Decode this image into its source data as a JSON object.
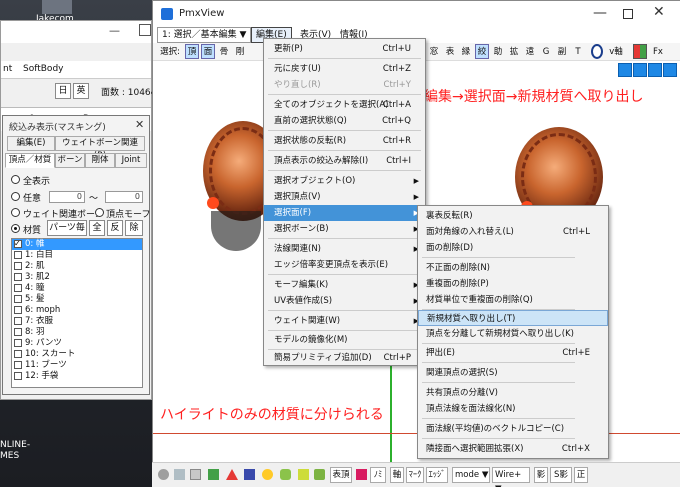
{
  "desktop": {
    "icon_label": "Jakecom",
    "bottom_lines": [
      "NLINE-",
      "MES"
    ]
  },
  "left_window": {
    "menu": [
      "nt",
      "SoftBody"
    ],
    "toolbar": {
      "mode_label": "日",
      "en_label": "英",
      "count_label": "面数 : 10464"
    },
    "table_header": [
      "",
      "0",
      "",
      "B"
    ]
  },
  "mask_window": {
    "title": "絞込み表示(マスキング)",
    "close": "✕",
    "tabs_row1": [
      "編集(E)",
      "ウェイトボーン関連(B)"
    ],
    "tabs_row2": [
      "頂点／材質",
      "ボーン",
      "剛体",
      "Joint"
    ],
    "radios": [
      {
        "label": "全表示",
        "on": false
      },
      {
        "label": "任意",
        "on": false,
        "num1": "0",
        "sep": "～",
        "num2": "0"
      },
      {
        "label": "ウェイト関連ボーン",
        "on": false,
        "extra": "頂点モーフ"
      },
      {
        "label": "材質",
        "on": true
      }
    ],
    "material_buttons": [
      "パーツ毎",
      "全",
      "反",
      "除"
    ],
    "materials": [
      {
        "label": "0: 帷",
        "checked": true,
        "selected": true
      },
      {
        "label": "1: 白目",
        "checked": false
      },
      {
        "label": "2: 肌",
        "checked": false
      },
      {
        "label": "3: 肌2",
        "checked": false
      },
      {
        "label": "4: 瞳",
        "checked": false
      },
      {
        "label": "5: 髪",
        "checked": false
      },
      {
        "label": "6: moph",
        "checked": false
      },
      {
        "label": "7: 衣服",
        "checked": false
      },
      {
        "label": "8: 羽",
        "checked": false
      },
      {
        "label": "9: パンツ",
        "checked": false
      },
      {
        "label": "10: スカート",
        "checked": false
      },
      {
        "label": "11: ブーツ",
        "checked": false
      },
      {
        "label": "12: 手袋",
        "checked": false
      }
    ]
  },
  "main_window": {
    "title": "PmxView",
    "minimize": "—",
    "close": "✕",
    "menubar": [
      "1: 選択／基本編集",
      "▼",
      "編集(E)",
      "表示(V)",
      "情報(I)"
    ],
    "toolbar_left": [
      "選択:",
      "頂",
      "面",
      "骨",
      "剛"
    ],
    "toolbar_right": [
      "窓",
      "表",
      "縁",
      "絞",
      "助",
      "拡",
      "遠",
      "G",
      "副",
      "T",
      "v軸",
      "Fx"
    ]
  },
  "annotations": {
    "top": "編集→選択面→新規材質へ取り出し",
    "bottom": "ハイライトのみの材質に分けられる"
  },
  "edit_menu": {
    "items": [
      {
        "label": "更新(P)",
        "key": "Ctrl+U"
      },
      {
        "sep": true
      },
      {
        "label": "元に戻す(U)",
        "key": "Ctrl+Z"
      },
      {
        "label": "やり直し(R)",
        "key": "Ctrl+Y",
        "disabled": true
      },
      {
        "sep": true
      },
      {
        "label": "全てのオブジェクトを選択(A)",
        "key": "Ctrl+A"
      },
      {
        "label": "直前の選択状態(Q)",
        "key": "Ctrl+Q"
      },
      {
        "sep": true
      },
      {
        "label": "選択状態の反転(R)",
        "key": "Ctrl+R"
      },
      {
        "sep": true
      },
      {
        "label": "頂点表示の絞込み解除(I)",
        "key": "Ctrl+I"
      },
      {
        "sep": true
      },
      {
        "label": "選択オブジェクト(O)",
        "arrow": true
      },
      {
        "label": "選択頂点(V)",
        "arrow": true
      },
      {
        "label": "選択面(F)",
        "arrow": true,
        "hot": true
      },
      {
        "label": "選択ボーン(B)",
        "arrow": true
      },
      {
        "sep": true
      },
      {
        "label": "法線関連(N)",
        "arrow": true
      },
      {
        "label": "エッジ倍率変更頂点を表示(E)"
      },
      {
        "sep": true
      },
      {
        "label": "モーフ編集(K)",
        "arrow": true
      },
      {
        "label": "UV表値作成(S)",
        "arrow": true
      },
      {
        "sep": true
      },
      {
        "label": "ウェイト関連(W)",
        "arrow": true
      },
      {
        "sep": true
      },
      {
        "label": "モデルの鏡像化(M)"
      },
      {
        "sep": true
      },
      {
        "label": "簡易プリミティブ追加(D)",
        "key": "Ctrl+P"
      }
    ]
  },
  "sub_menu": {
    "items": [
      {
        "label": "裏表反転(R)"
      },
      {
        "label": "面対角線の入れ替え(L)",
        "key": "Ctrl+L"
      },
      {
        "label": "面の削除(D)"
      },
      {
        "sep": true
      },
      {
        "label": "不正面の削除(N)"
      },
      {
        "label": "重複面の削除(P)"
      },
      {
        "label": "材質単位で重複面の削除(Q)"
      },
      {
        "sep": true
      },
      {
        "label": "新規材質へ取り出し(T)",
        "hot": true
      },
      {
        "label": "頂点を分離して新規材質へ取り出し(K)"
      },
      {
        "sep": true
      },
      {
        "label": "押出(E)",
        "key": "Ctrl+E"
      },
      {
        "sep": true
      },
      {
        "label": "関連頂点の選択(S)"
      },
      {
        "sep": true
      },
      {
        "label": "共有頂点の分離(V)"
      },
      {
        "label": "頂点法線を面法線化(N)"
      },
      {
        "sep": true
      },
      {
        "label": "面法線(平均値)のベクトルコピー(C)"
      },
      {
        "sep": true
      },
      {
        "label": "隣接面へ選択範囲拡張(X)",
        "key": "Ctrl+X"
      }
    ]
  },
  "bottom_bar": {
    "buttons": [
      "表頂",
      "ﾉﾐ",
      "軸",
      "ﾏｰｸ",
      "ｴｯｼﾞ",
      "mode",
      "▼",
      "Wire+",
      "▼",
      "影",
      "S影",
      "正"
    ]
  },
  "colors": {
    "accent": "#4393d8",
    "annotation": "#ff2020",
    "hot_sub": "#cce4f7"
  }
}
